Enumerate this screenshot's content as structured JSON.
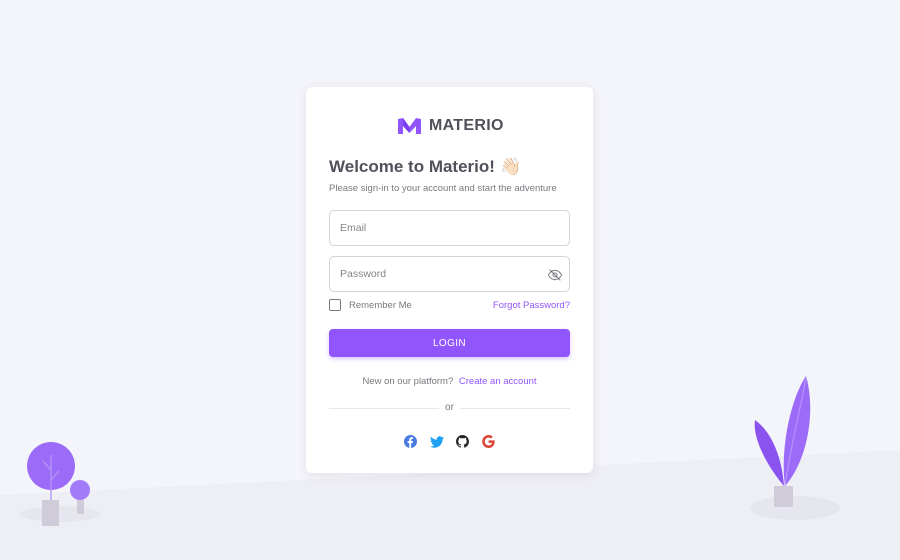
{
  "brand": {
    "name": "MATERIO",
    "accent": "#9155fd"
  },
  "welcome": {
    "title": "Welcome to Materio!",
    "emoji": "👋🏻",
    "subtitle": "Please sign-in to your account and start the adventure"
  },
  "form": {
    "email_placeholder": "Email",
    "password_placeholder": "Password",
    "remember_label": "Remember Me",
    "remember_checked": false,
    "forgot_label": "Forgot Password?",
    "login_label": "LOGIN"
  },
  "signup": {
    "prompt": "New on our platform?",
    "link": "Create an account"
  },
  "divider": {
    "text": "or"
  },
  "socials": [
    {
      "icon": "facebook-icon",
      "color": "#497ce2"
    },
    {
      "icon": "twitter-icon",
      "color": "#1da1f2"
    },
    {
      "icon": "github-icon",
      "color": "#272727"
    },
    {
      "icon": "google-icon",
      "color": "#db4437"
    }
  ]
}
